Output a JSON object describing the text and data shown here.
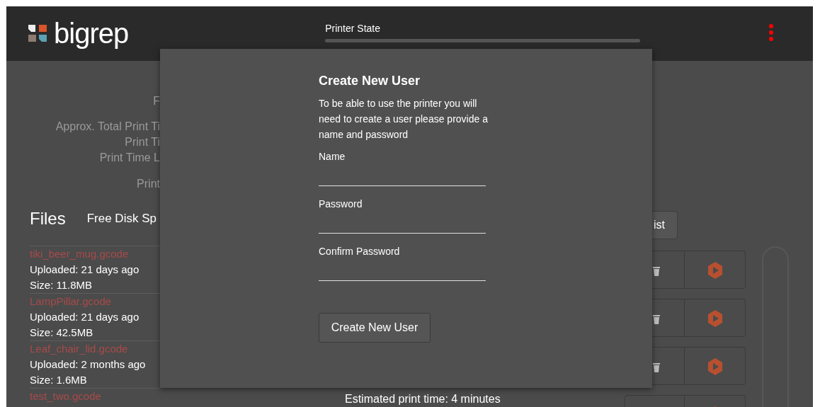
{
  "header": {
    "logo": "bigrep",
    "printer_state": {
      "label": "Printer State"
    }
  },
  "stats": [
    "F",
    "Approx. Total Print Ti",
    "Print Ti",
    "Print Time L",
    "Print"
  ],
  "files": {
    "title": "Files",
    "free_disk": "Free Disk Sp",
    "list_button": "ist",
    "items": [
      {
        "name": "tiki_beer_mug.gcode",
        "uploaded": "Uploaded: 21 days ago",
        "size": "Size: 11.8MB"
      },
      {
        "name": "LampPillar.gcode",
        "uploaded": "Uploaded: 21 days ago",
        "size": "Size: 42.5MB"
      },
      {
        "name": "Leaf_chair_lid.gcode",
        "uploaded": "Uploaded: 2 months ago",
        "size": "Size: 1.6MB"
      },
      {
        "name": "test_two.gcode"
      }
    ],
    "estimate": "Estimated print time: 4 minutes"
  },
  "dialog": {
    "title": "Create New User",
    "description": "To be able to use the printer you will need to create a user please provide a name and password",
    "fields": [
      {
        "label": "Name"
      },
      {
        "label": "Password"
      },
      {
        "label": "Confirm Password"
      }
    ],
    "button": "Create New User"
  }
}
